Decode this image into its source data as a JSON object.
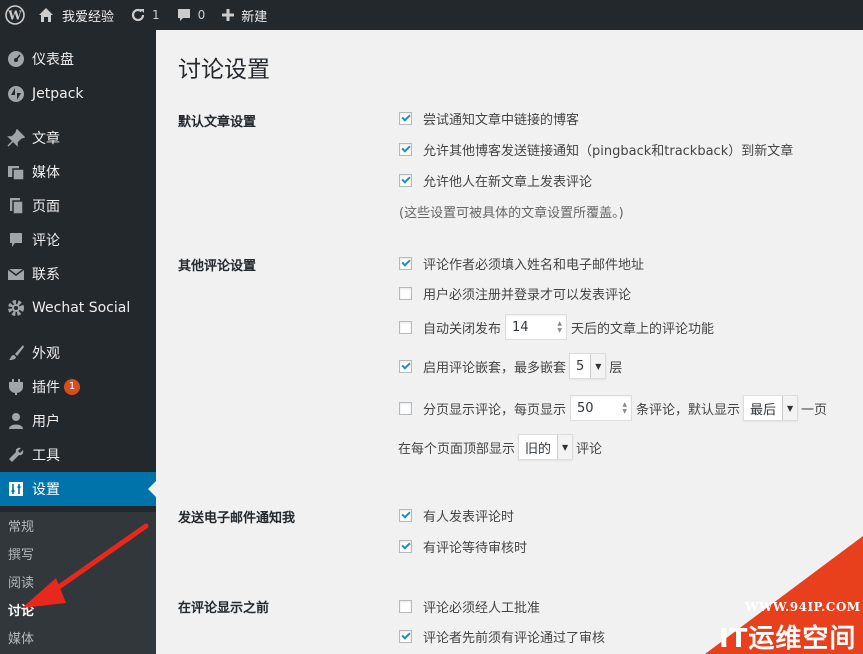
{
  "adminbar": {
    "site_name": "我爱经验",
    "updates_count": "1",
    "comments_count": "0",
    "new_label": "新建"
  },
  "sidebar": {
    "items": [
      {
        "label": "仪表盘",
        "icon": "dashboard-icon"
      },
      {
        "label": "Jetpack",
        "icon": "jetpack-icon"
      },
      {
        "label": "文章",
        "icon": "pin-icon"
      },
      {
        "label": "媒体",
        "icon": "media-icon"
      },
      {
        "label": "页面",
        "icon": "page-icon"
      },
      {
        "label": "评论",
        "icon": "comment-icon"
      },
      {
        "label": "联系",
        "icon": "mail-icon"
      },
      {
        "label": "Wechat Social",
        "icon": "gear-icon"
      },
      {
        "label": "外观",
        "icon": "brush-icon"
      },
      {
        "label": "插件",
        "icon": "plugin-icon",
        "badge": "1"
      },
      {
        "label": "用户",
        "icon": "user-icon"
      },
      {
        "label": "工具",
        "icon": "wrench-icon"
      },
      {
        "label": "设置",
        "icon": "settings-icon"
      }
    ],
    "submenu": [
      "常规",
      "撰写",
      "阅读",
      "讨论",
      "媒体"
    ]
  },
  "main": {
    "title": "讨论设置",
    "default_article": {
      "label": "默认文章设置",
      "opt1": "尝试通知文章中链接的博客",
      "opt2": "允许其他博客发送链接通知（pingback和trackback）到新文章",
      "opt3": "允许他人在新文章上发表评论",
      "note": "(这些设置可被具体的文章设置所覆盖。)"
    },
    "other_comments": {
      "label": "其他评论设置",
      "opt1": "评论作者必须填入姓名和电子邮件地址",
      "opt2": "用户必须注册并登录才可以发表评论",
      "opt3_pre": "自动关闭发布",
      "opt3_value": "14",
      "opt3_post": "天后的文章上的评论功能",
      "opt4_pre": "启用评论嵌套，最多嵌套",
      "opt4_value": "5",
      "opt4_post": "层",
      "opt5_pre": "分页显示评论，每页显示",
      "opt5_value": "50",
      "opt5_mid": "条评论，默认显示",
      "opt5_select": "最后",
      "opt5_post": "一页",
      "opt6_pre": "在每个页面顶部显示",
      "opt6_select": "旧的",
      "opt6_post": "评论"
    },
    "email_me": {
      "label": "发送电子邮件通知我",
      "opt1": "有人发表评论时",
      "opt2": "有评论等待审核时"
    },
    "before_appear": {
      "label": "在评论显示之前",
      "opt1": "评论必须经人工批准",
      "opt2": "评论者先前须有评论通过了审核"
    }
  },
  "watermark": {
    "url": "WWW.94IP.COM",
    "name": "IT运维空间"
  },
  "colors": {
    "sidebar_bg": "#23282d",
    "active_bg": "#0073aa",
    "badge": "#d54e21",
    "arrow": "#e8281c",
    "watermark": "#e8401c"
  }
}
